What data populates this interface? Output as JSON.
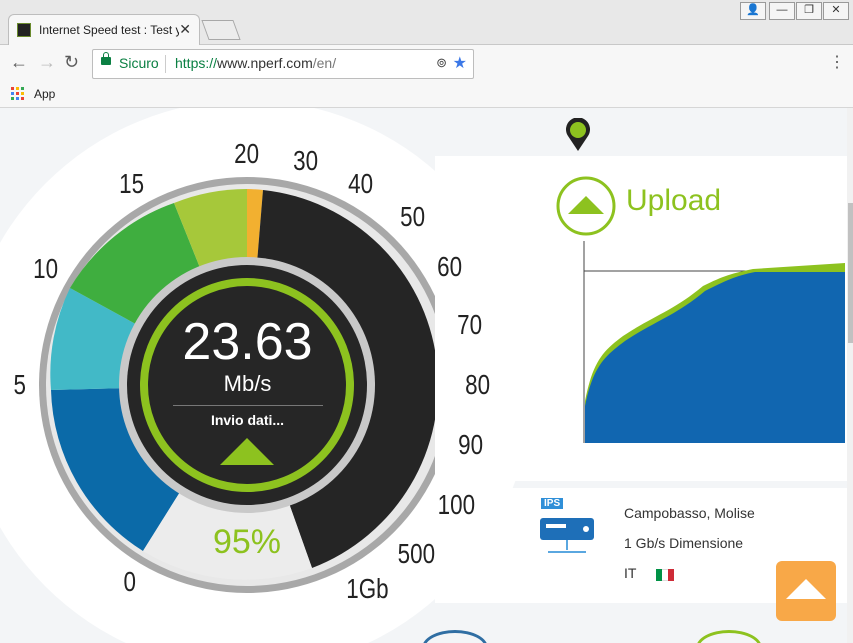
{
  "browser": {
    "tab_title": "Internet Speed test : Test y",
    "secure_label": "Sicuro",
    "url_scheme": "https://",
    "url_host": "www.nperf.com",
    "url_path": "/en/",
    "bookmarks": [
      {
        "label": "App"
      }
    ]
  },
  "gauge": {
    "value": "23.63",
    "unit": "Mb/s",
    "phase": "Invio dati...",
    "percent": "95%",
    "ticks": [
      "0",
      "5",
      "10",
      "15",
      "20",
      "30",
      "40",
      "50",
      "60",
      "70",
      "80",
      "90",
      "100",
      "500",
      "1Gb"
    ]
  },
  "upload": {
    "title": "Upload"
  },
  "server": {
    "badge": "IPS",
    "location": "Campobasso, Molise",
    "bandwidth": "1 Gb/s Dimensione",
    "country": "IT"
  },
  "colors": {
    "accent_green": "#8dc21f",
    "graph_blue": "#1166b0",
    "orange": "#f8a848",
    "gauge_dark": "#252525"
  }
}
